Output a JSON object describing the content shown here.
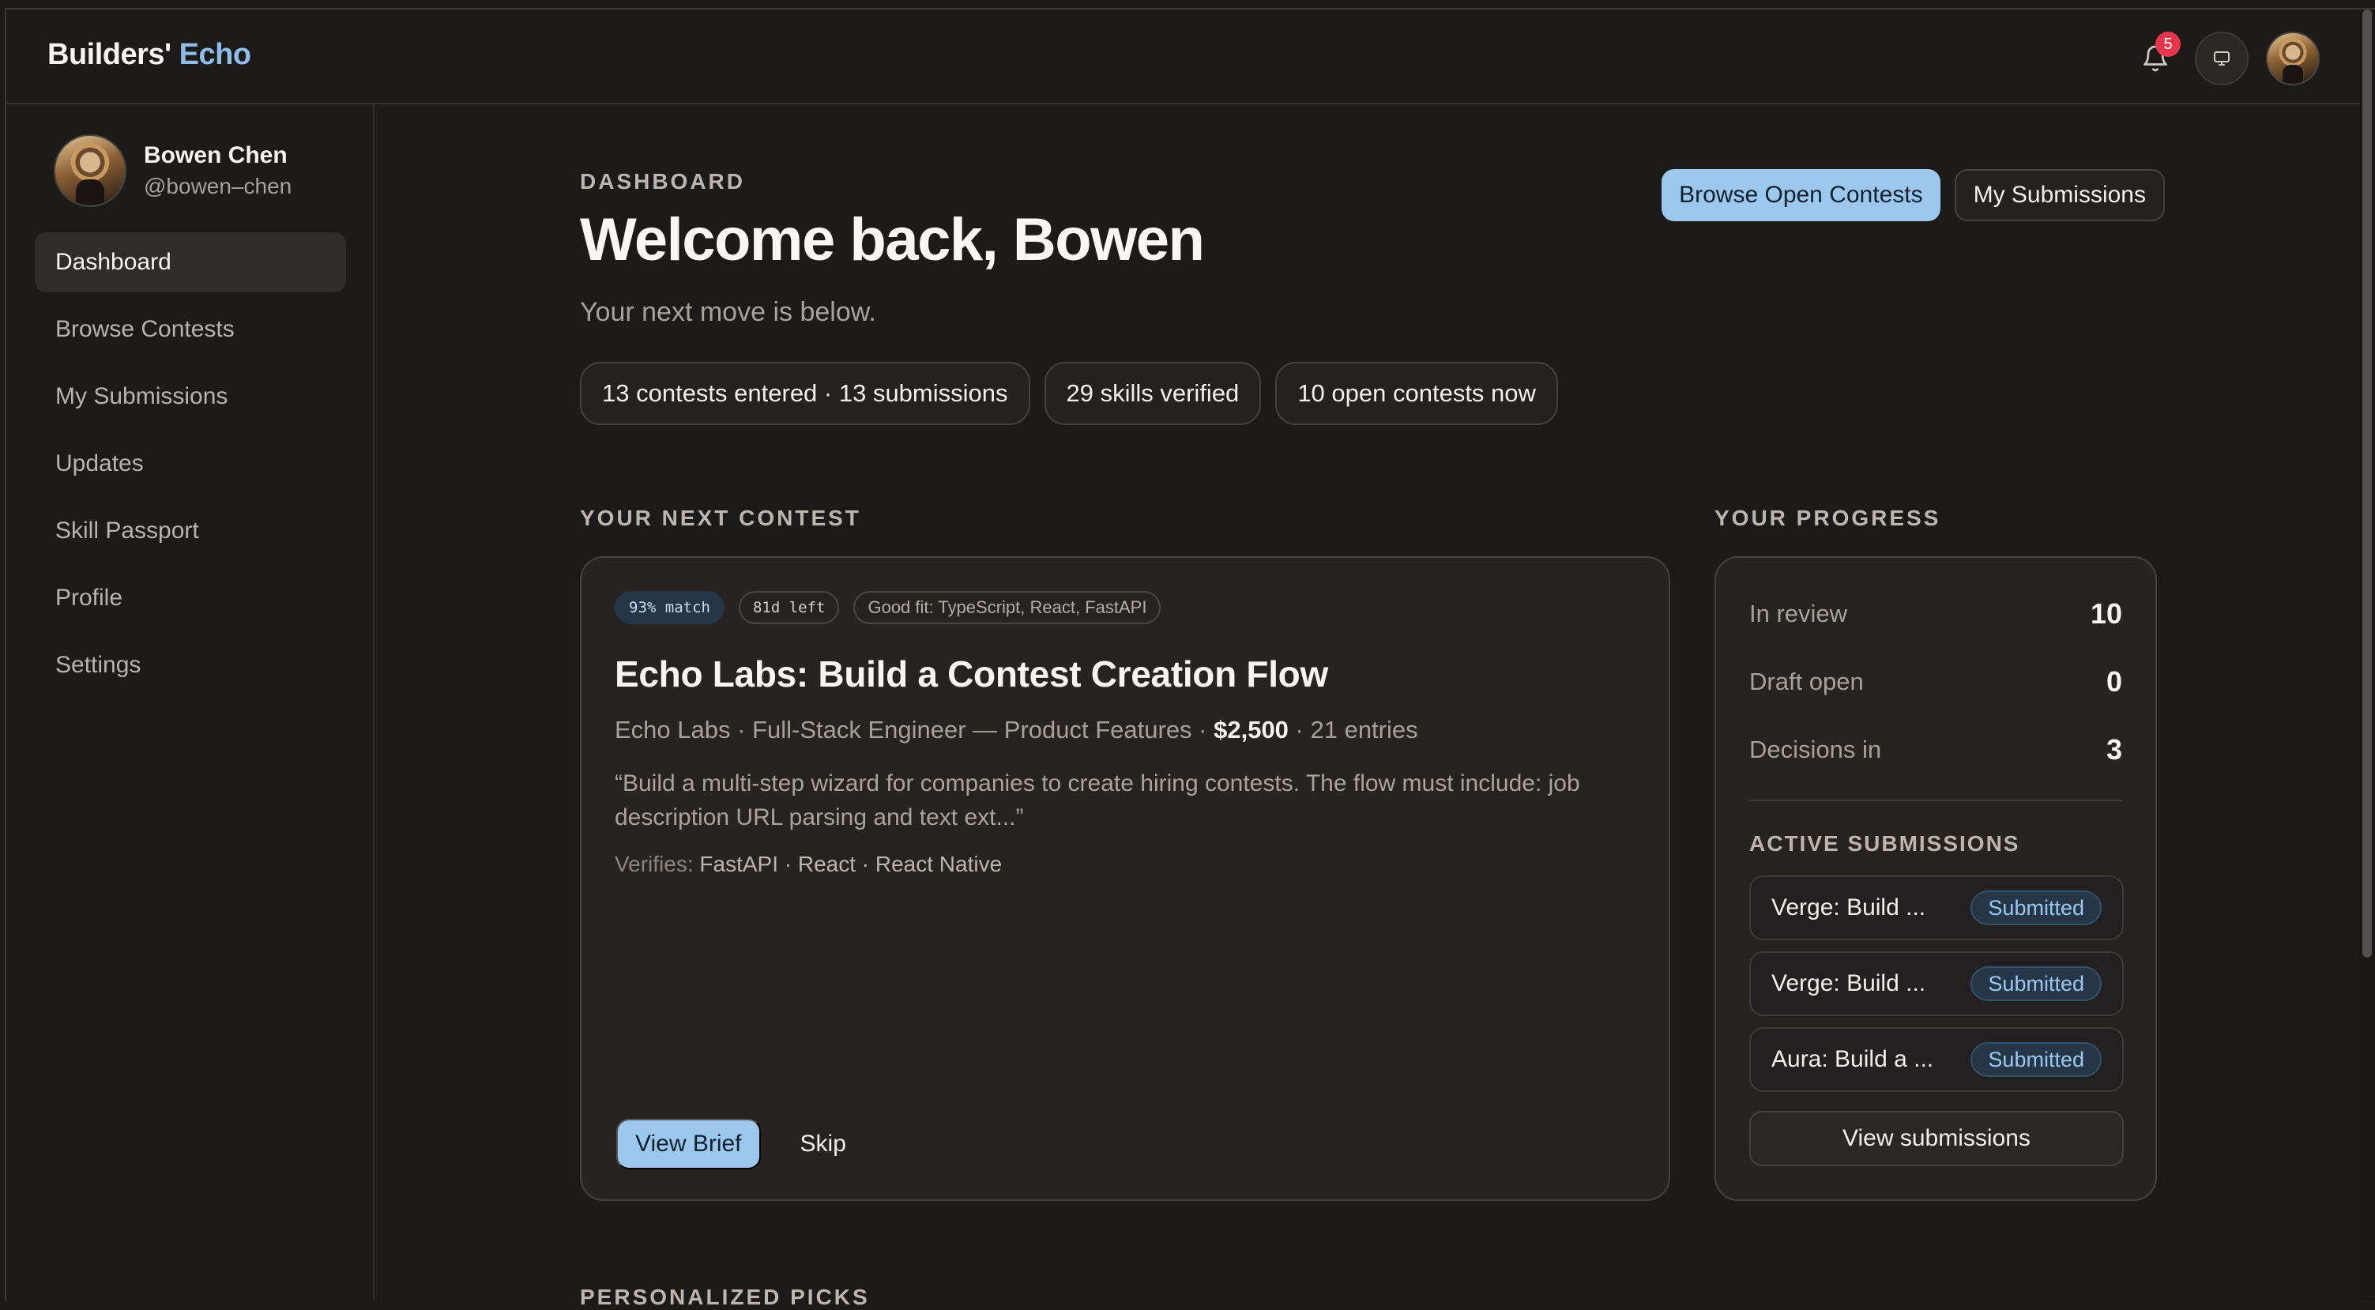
{
  "brand": {
    "name": "Builders'",
    "accent": "Echo"
  },
  "topbar": {
    "notification_count": "5",
    "icons": [
      "bell-icon",
      "monitor-icon",
      "user-avatar"
    ]
  },
  "sidebar": {
    "user": {
      "name": "Bowen Chen",
      "handle": "@bowen–chen"
    },
    "items": [
      {
        "label": "Dashboard",
        "active": true
      },
      {
        "label": "Browse Contests"
      },
      {
        "label": "My Submissions"
      },
      {
        "label": "Updates"
      },
      {
        "label": "Skill Passport"
      },
      {
        "label": "Profile"
      },
      {
        "label": "Settings"
      }
    ]
  },
  "header": {
    "crumb": "DASHBOARD",
    "title": "Welcome back, Bowen",
    "subtitle": "Your next move is below.",
    "primary_action": "Browse Open Contests",
    "secondary_action": "My Submissions"
  },
  "stats": [
    "13 contests entered · 13 submissions",
    "29 skills verified",
    "10 open contests now"
  ],
  "next_contest": {
    "section_label": "YOUR NEXT CONTEST",
    "tags": {
      "match": "93% match",
      "time_left": "81d left",
      "fit": "Good fit: TypeScript, React, FastAPI"
    },
    "title": "Echo Labs: Build a Contest Creation Flow",
    "meta_prefix": "Echo Labs · Full-Stack Engineer — Product Features · ",
    "prize": "$2,500",
    "meta_suffix": " · 21 entries",
    "quote": "“Build a multi-step wizard for companies to create hiring contests. The flow must include: job description URL parsing and text ext...”",
    "verifies_label": "Verifies: ",
    "verifies_values": "FastAPI · React · React Native",
    "primary_action": "View Brief",
    "secondary_action": "Skip"
  },
  "progress": {
    "section_label": "YOUR PROGRESS",
    "metrics": [
      {
        "label": "In review",
        "value": "10"
      },
      {
        "label": "Draft open",
        "value": "0"
      },
      {
        "label": "Decisions in",
        "value": "3"
      }
    ],
    "active_label": "ACTIVE SUBMISSIONS",
    "submissions": [
      {
        "title": "Verge: Build ...",
        "status": "Submitted"
      },
      {
        "title": "Verge: Build ...",
        "status": "Submitted"
      },
      {
        "title": "Aura: Build a ...",
        "status": "Submitted"
      }
    ],
    "view_all": "View submissions"
  },
  "picks": {
    "section_label": "PERSONALIZED PICKS"
  },
  "colors": {
    "accent": "#9cc8ee",
    "brand_accent": "#8fbde8",
    "badge": "#e5364e",
    "background": "#1d1b1a",
    "card": "#262321"
  }
}
